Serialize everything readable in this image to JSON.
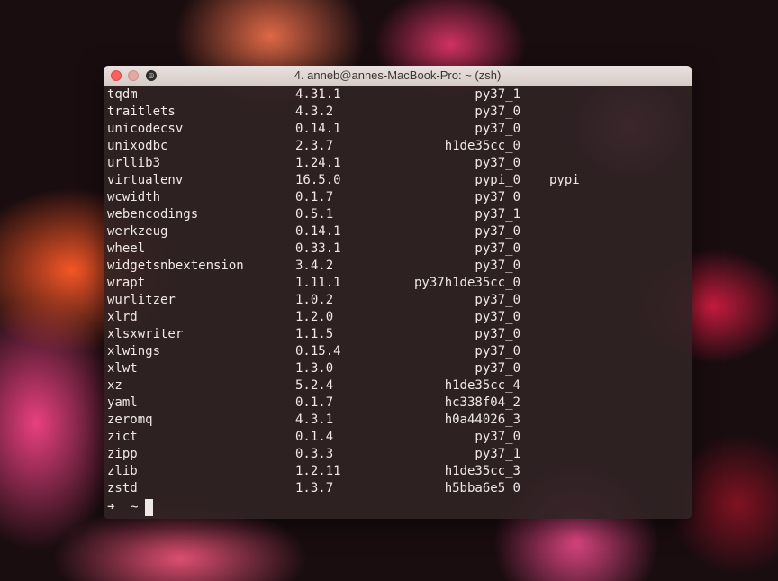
{
  "window": {
    "title": "4. anneb@annes-MacBook-Pro: ~ (zsh)",
    "icons": [
      "close-icon",
      "minimize-icon",
      "zsh-icon"
    ]
  },
  "packages": [
    {
      "name": "tqdm",
      "version": "4.31.1",
      "build": "py37_1",
      "channel": ""
    },
    {
      "name": "traitlets",
      "version": "4.3.2",
      "build": "py37_0",
      "channel": ""
    },
    {
      "name": "unicodecsv",
      "version": "0.14.1",
      "build": "py37_0",
      "channel": ""
    },
    {
      "name": "unixodbc",
      "version": "2.3.7",
      "build": "h1de35cc_0",
      "channel": ""
    },
    {
      "name": "urllib3",
      "version": "1.24.1",
      "build": "py37_0",
      "channel": ""
    },
    {
      "name": "virtualenv",
      "version": "16.5.0",
      "build": "pypi_0",
      "channel": "pypi"
    },
    {
      "name": "wcwidth",
      "version": "0.1.7",
      "build": "py37_0",
      "channel": ""
    },
    {
      "name": "webencodings",
      "version": "0.5.1",
      "build": "py37_1",
      "channel": ""
    },
    {
      "name": "werkzeug",
      "version": "0.14.1",
      "build": "py37_0",
      "channel": ""
    },
    {
      "name": "wheel",
      "version": "0.33.1",
      "build": "py37_0",
      "channel": ""
    },
    {
      "name": "widgetsnbextension",
      "version": "3.4.2",
      "build": "py37_0",
      "channel": ""
    },
    {
      "name": "wrapt",
      "version": "1.11.1",
      "build": "py37h1de35cc_0",
      "channel": ""
    },
    {
      "name": "wurlitzer",
      "version": "1.0.2",
      "build": "py37_0",
      "channel": ""
    },
    {
      "name": "xlrd",
      "version": "1.2.0",
      "build": "py37_0",
      "channel": ""
    },
    {
      "name": "xlsxwriter",
      "version": "1.1.5",
      "build": "py37_0",
      "channel": ""
    },
    {
      "name": "xlwings",
      "version": "0.15.4",
      "build": "py37_0",
      "channel": ""
    },
    {
      "name": "xlwt",
      "version": "1.3.0",
      "build": "py37_0",
      "channel": ""
    },
    {
      "name": "xz",
      "version": "5.2.4",
      "build": "h1de35cc_4",
      "channel": ""
    },
    {
      "name": "yaml",
      "version": "0.1.7",
      "build": "hc338f04_2",
      "channel": ""
    },
    {
      "name": "zeromq",
      "version": "4.3.1",
      "build": "h0a44026_3",
      "channel": ""
    },
    {
      "name": "zict",
      "version": "0.1.4",
      "build": "py37_0",
      "channel": ""
    },
    {
      "name": "zipp",
      "version": "0.3.3",
      "build": "py37_1",
      "channel": ""
    },
    {
      "name": "zlib",
      "version": "1.2.11",
      "build": "h1de35cc_3",
      "channel": ""
    },
    {
      "name": "zstd",
      "version": "1.3.7",
      "build": "h5bba6e5_0",
      "channel": ""
    }
  ],
  "prompt": {
    "arrow": "➜",
    "cwd": "~"
  }
}
